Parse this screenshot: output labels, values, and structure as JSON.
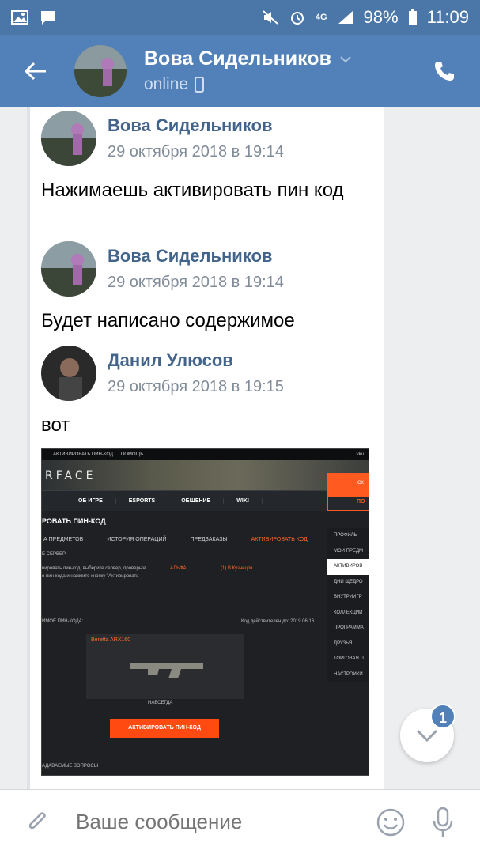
{
  "statusbar": {
    "signal_label": "4G",
    "battery": "98%",
    "time": "11:09"
  },
  "header": {
    "name": "Вова Сидельников",
    "status": "online"
  },
  "messages": [
    {
      "author": "Вова Сидельников",
      "date": "29 октября 2018 в 19:14",
      "text": "Нажимаешь активировать пин код"
    },
    {
      "author": "Вова Сидельников",
      "date": "29 октября 2018 в 19:14",
      "text": "Будет написано содержимое"
    },
    {
      "author": "Данил Улюсов",
      "date": "29 октября 2018 в 19:15",
      "text": "вот"
    }
  ],
  "screenshot": {
    "topbar": [
      "АКТИВИРОВАТЬ ПИН-КОД",
      "ПОМОЩЬ"
    ],
    "user": "vku",
    "logo": "RFACE",
    "banner_button": "СК",
    "nav": [
      "ОБ ИГРЕ",
      "ESPORTS",
      "ОБЩЕНИЕ",
      "WIKI"
    ],
    "nav_button": "ПО",
    "page_title": "РОВАТЬ ПИН-КОД",
    "tabs": [
      "А ПРЕДМЕТОВ",
      "ИСТОРИЯ ОПЕРАЦИЙ",
      "ПРЕДЗАКАЗЫ",
      "АКТИВИРОВАТЬ КОД"
    ],
    "sidebar": [
      "ПРОФИЛЬ",
      "МОИ ПРЕДМ",
      "АКТИВИРОВ",
      "ДНИ ЩЕДРО",
      "ВНУТРИИГР",
      "КОЛЛЕКЦИИ",
      "ПРОГРАММА",
      "ДРУЗЬЯ",
      "ТОРГОВАЯ П",
      "НАСТРОЙКИ"
    ],
    "server_label": "Е СЕРВЕР",
    "server_hint_1": "вировать пин-код, выберите сервер, проверьте",
    "server_hint_2": "о пин-кода и нажмите кнопку \"Активировать",
    "server_name": "АЛЬФА",
    "server_char": "(1) В.Кузнецов",
    "content_label": "ИМОЕ ПИН-КОДА:",
    "valid_until": "Код действителен до: 2019.06.16",
    "item_name": "Beretta ARX160",
    "item_duration": "НАВСЕГДА",
    "activate_button": "АКТИВИРОВАТЬ ПИН-КОД",
    "faq": "АДАВАЕМЫЕ ВОПРОСЫ"
  },
  "unread_count": "1",
  "composer": {
    "placeholder": "Ваше сообщение"
  },
  "colors": {
    "header": "#5181b8",
    "accent": "#4a76a8",
    "link": "#42648b",
    "orange": "#ff5a1f"
  }
}
